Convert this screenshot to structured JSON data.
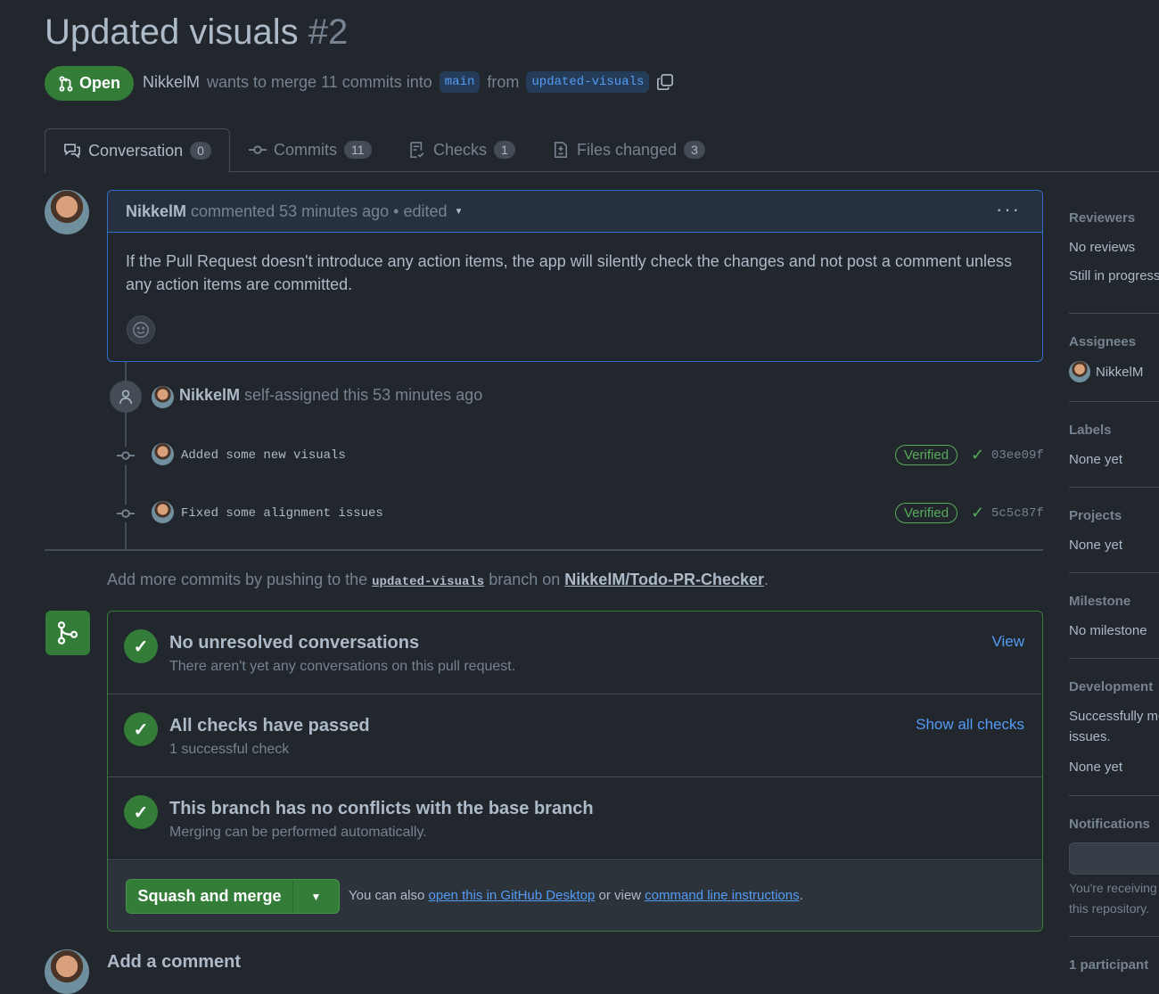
{
  "pr": {
    "title": "Updated visuals",
    "number": "#2",
    "state": "Open",
    "author": "NikkelM",
    "merge_text": "wants to merge 11 commits into",
    "base_branch": "main",
    "from_text": "from",
    "head_branch": "updated-visuals"
  },
  "tabs": [
    {
      "label": "Conversation",
      "count": "0"
    },
    {
      "label": "Commits",
      "count": "11"
    },
    {
      "label": "Checks",
      "count": "1"
    },
    {
      "label": "Files changed",
      "count": "3"
    }
  ],
  "comment": {
    "author": "NikkelM",
    "meta": "commented 53 minutes ago • edited",
    "menu": "···",
    "body": "If the Pull Request doesn't introduce any action items, the app will silently check the changes and not post a comment unless any action items are committed."
  },
  "events": {
    "assign_user": "NikkelM",
    "assign_text": "self-assigned this 53 minutes ago",
    "commits": [
      {
        "message": "Added some new visuals",
        "badge": "Verified",
        "sha": "03ee09f"
      },
      {
        "message": "Fixed some alignment issues",
        "badge": "Verified",
        "sha": "5c5c87f"
      }
    ]
  },
  "hint": {
    "prefix": "Add more commits by pushing to the",
    "branch": "updated-visuals",
    "mid": "branch on",
    "repo": "NikkelM/Todo-PR-Checker",
    "end": "."
  },
  "merge": {
    "rows": [
      {
        "title": "No unresolved conversations",
        "sub": "There aren't yet any conversations on this pull request.",
        "link": "View"
      },
      {
        "title": "All checks have passed",
        "sub": "1 successful check",
        "link": "Show all checks"
      },
      {
        "title": "This branch has no conflicts with the base branch",
        "sub": "Merging can be performed automatically.",
        "link": ""
      }
    ],
    "button": "Squash and merge",
    "foot_prefix": "You can also",
    "foot_link1": "open this in GitHub Desktop",
    "foot_mid": "or view",
    "foot_link2": "command line instructions",
    "foot_end": "."
  },
  "add_comment": "Add a comment",
  "sidebar": {
    "reviewers": {
      "heading": "Reviewers",
      "value": "No reviews",
      "value2": "Still in progress"
    },
    "assignees": {
      "heading": "Assignees",
      "value": "NikkelM"
    },
    "labels": {
      "heading": "Labels",
      "value": "None yet"
    },
    "projects": {
      "heading": "Projects",
      "value": "None yet"
    },
    "milestone": {
      "heading": "Milestone",
      "value": "No milestone"
    },
    "development": {
      "heading": "Development",
      "value": "Successfully me",
      "value2": "issues.",
      "value3": "None yet"
    },
    "notifications": {
      "heading": "Notifications",
      "value": "You're receiving",
      "value2": "this repository."
    },
    "participants": {
      "heading": "1 participant"
    }
  },
  "colors": {
    "background": "#22272e",
    "accent_green": "#347d39",
    "link_blue": "#539bf5",
    "comment_border": "#316dca"
  }
}
